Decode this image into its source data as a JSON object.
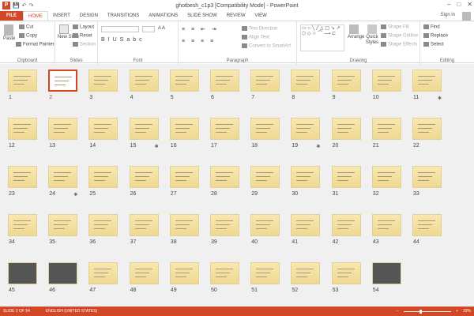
{
  "window": {
    "title": "ghotbesh_c1p3 [Compatibility Mode] - PowerPoint",
    "minimize": "–",
    "maximize": "□",
    "close": "✕"
  },
  "qat": {
    "logo": "P",
    "save": "💾",
    "undo": "↶",
    "redo": "↷"
  },
  "tabs": [
    "FILE",
    "HOME",
    "INSERT",
    "DESIGN",
    "TRANSITIONS",
    "ANIMATIONS",
    "SLIDE SHOW",
    "REVIEW",
    "VIEW"
  ],
  "signin": "Sign in",
  "ribbon": {
    "clipboard": {
      "label": "Clipboard",
      "paste": "Paste",
      "cut": "Cut",
      "copy": "Copy",
      "format_painter": "Format Painter"
    },
    "slides": {
      "label": "Slides",
      "new_slide": "New Slide",
      "layout": "Layout",
      "reset": "Reset",
      "section": "Section"
    },
    "font": {
      "label": "Font"
    },
    "paragraph": {
      "label": "Paragraph",
      "text_direction": "Text Direction",
      "align_text": "Align Text",
      "smartart": "Convert to SmartArt"
    },
    "drawing": {
      "label": "Drawing",
      "arrange": "Arrange",
      "quick_styles": "Quick Styles",
      "shape_fill": "Shape Fill",
      "shape_outline": "Shape Outline",
      "shape_effects": "Shape Effects"
    },
    "editing": {
      "label": "Editing",
      "find": "Find",
      "replace": "Replace",
      "select": "Select"
    }
  },
  "slides": [
    {
      "num": "1",
      "star": false
    },
    {
      "num": "2",
      "star": false,
      "selected": true
    },
    {
      "num": "3",
      "star": false
    },
    {
      "num": "4",
      "star": false
    },
    {
      "num": "5",
      "star": false
    },
    {
      "num": "6",
      "star": false
    },
    {
      "num": "7",
      "star": false
    },
    {
      "num": "8",
      "star": false
    },
    {
      "num": "9",
      "star": false
    },
    {
      "num": "10",
      "star": false
    },
    {
      "num": "11",
      "star": true
    },
    {
      "num": "12",
      "star": false
    },
    {
      "num": "13",
      "star": false
    },
    {
      "num": "14",
      "star": false
    },
    {
      "num": "15",
      "star": true
    },
    {
      "num": "16",
      "star": false
    },
    {
      "num": "17",
      "star": false
    },
    {
      "num": "18",
      "star": false
    },
    {
      "num": "19",
      "star": true
    },
    {
      "num": "20",
      "star": false
    },
    {
      "num": "21",
      "star": false
    },
    {
      "num": "22",
      "star": false
    },
    {
      "num": "23",
      "star": false
    },
    {
      "num": "24",
      "star": true
    },
    {
      "num": "25",
      "star": false
    },
    {
      "num": "26",
      "star": false
    },
    {
      "num": "27",
      "star": false
    },
    {
      "num": "28",
      "star": false
    },
    {
      "num": "29",
      "star": false
    },
    {
      "num": "30",
      "star": false
    },
    {
      "num": "31",
      "star": false
    },
    {
      "num": "32",
      "star": false
    },
    {
      "num": "33",
      "star": false
    },
    {
      "num": "34",
      "star": false
    },
    {
      "num": "35",
      "star": false
    },
    {
      "num": "36",
      "star": false
    },
    {
      "num": "37",
      "star": false
    },
    {
      "num": "38",
      "star": false
    },
    {
      "num": "39",
      "star": false
    },
    {
      "num": "40",
      "star": false
    },
    {
      "num": "41",
      "star": false
    },
    {
      "num": "42",
      "star": false
    },
    {
      "num": "43",
      "star": false
    },
    {
      "num": "44",
      "star": false
    },
    {
      "num": "45",
      "star": false,
      "dark": true
    },
    {
      "num": "46",
      "star": false,
      "dark": true
    },
    {
      "num": "47",
      "star": false
    },
    {
      "num": "48",
      "star": false
    },
    {
      "num": "49",
      "star": false
    },
    {
      "num": "50",
      "star": false
    },
    {
      "num": "51",
      "star": false
    },
    {
      "num": "52",
      "star": false
    },
    {
      "num": "53",
      "star": false
    },
    {
      "num": "54",
      "star": false,
      "dark": true
    }
  ],
  "star_glyph": "✱",
  "status": {
    "slide_info": "SLIDE 2 OF 54",
    "language": "ENGLISH (UNITED STATES)",
    "zoom": "33%",
    "zoom_fraction": 0.33
  },
  "colors": {
    "accent": "#d24726",
    "slide_bg": "#f3dfa0"
  }
}
